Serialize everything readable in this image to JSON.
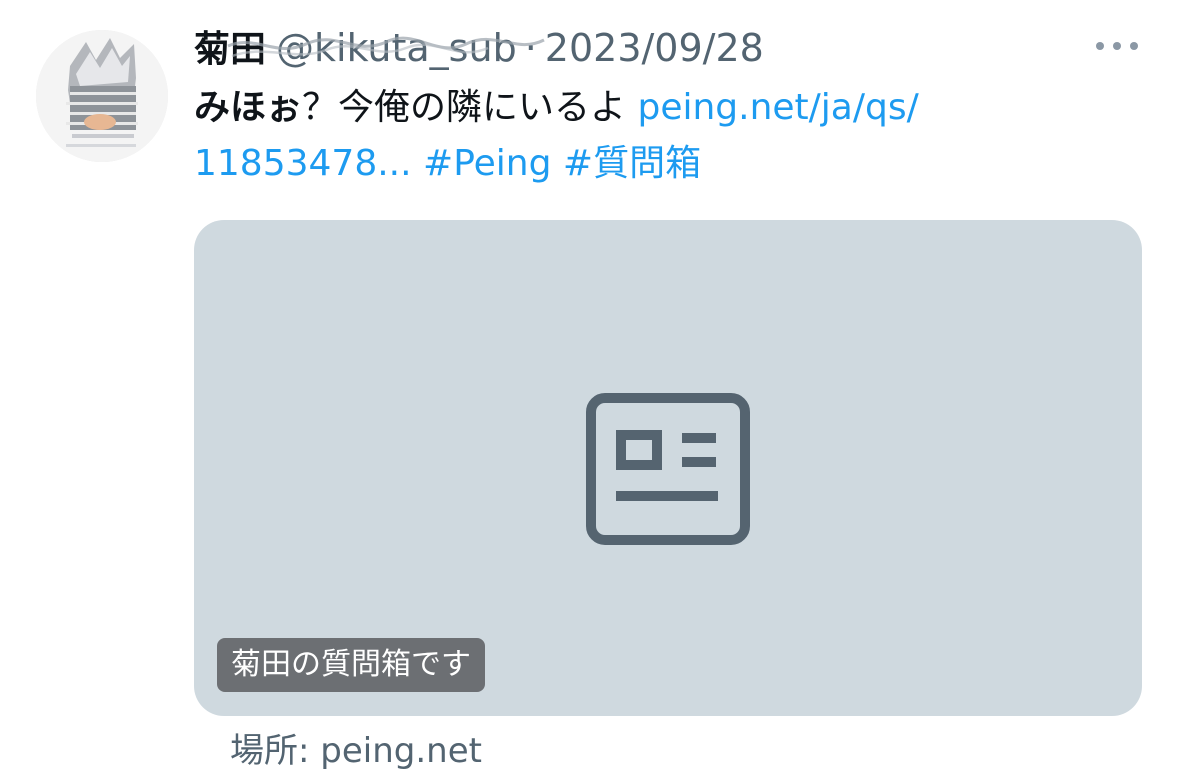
{
  "tweet": {
    "author_name": "菊田",
    "author_handle": "@kikuta_sub",
    "separator": "·",
    "date": "2023/09/28",
    "text_lead": "みほぉ",
    "text_body": "？今俺の隣にいるよ ",
    "link_url": "peing.net/ja/qs/ 11853478...",
    "hashtag_1": "#Peing",
    "hashtag_2": "#質問箱"
  },
  "card": {
    "icon": "article-icon",
    "caption": "菊田の質問箱です",
    "location": "場所: peing.net"
  },
  "colors": {
    "link": "#1d9bf0",
    "secondary_text": "#536471",
    "card_background": "#cfd9df",
    "card_icon": "#556470",
    "caption_background": "#6c6f73"
  }
}
